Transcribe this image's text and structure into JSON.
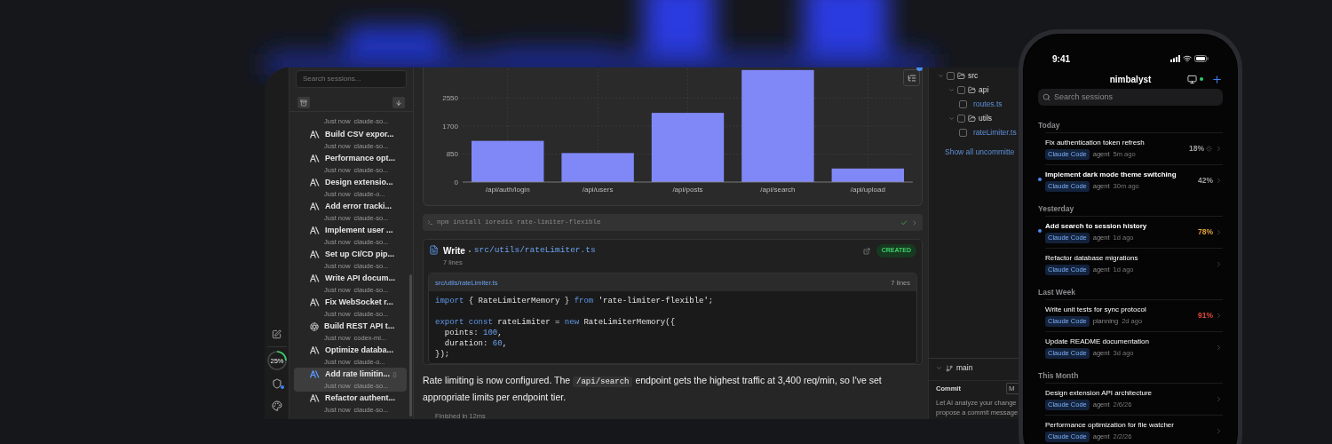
{
  "desktop": {
    "rail": {
      "usage": {
        "label": "25%",
        "level": 0.25
      },
      "shield_notice": true
    },
    "sidebar": {
      "search": {
        "placeholder": "Search sessions..."
      },
      "sessions": [
        {
          "kind": "cut",
          "time": "Just now",
          "source": "claude-so..."
        },
        {
          "kind": "claude",
          "title": "Build CSV expor...",
          "time": "Just now",
          "source": "claude-so...",
          "selected": false
        },
        {
          "kind": "claude",
          "title": "Performance opt...",
          "time": "Just now",
          "source": "claude-so...",
          "selected": false
        },
        {
          "kind": "claude",
          "title": "Design extensio...",
          "time": "Just now",
          "source": "claude-o...",
          "selected": false
        },
        {
          "kind": "claude",
          "title": "Add error tracki...",
          "time": "Just now",
          "source": "claude-so...",
          "selected": false
        },
        {
          "kind": "claude",
          "title": "Implement user ...",
          "time": "Just now",
          "source": "claude-so...",
          "selected": false
        },
        {
          "kind": "claude",
          "title": "Set up CI/CD pip...",
          "time": "Just now",
          "source": "claude-so...",
          "selected": false
        },
        {
          "kind": "claude",
          "title": "Write API docum...",
          "time": "Just now",
          "source": "claude-so...",
          "selected": false
        },
        {
          "kind": "claude",
          "title": "Fix WebSocket r...",
          "time": "Just now",
          "source": "claude-so...",
          "selected": false
        },
        {
          "kind": "codex",
          "title": "Build REST API t...",
          "time": "Just now",
          "source": "codex-mi...",
          "selected": false
        },
        {
          "kind": "claude",
          "title": "Optimize databa...",
          "time": "Just now",
          "source": "claude-o...",
          "selected": false
        },
        {
          "kind": "claude",
          "title": "Add rate limitin...",
          "time": "Just now",
          "source": "claude-so...",
          "selected": true
        },
        {
          "kind": "claude",
          "title": "Refactor authent...",
          "time": "Just now",
          "source": "claude-so...",
          "selected": false
        }
      ]
    },
    "main": {
      "chart_data": {
        "type": "bar",
        "categories": [
          "/api/auth/login",
          "/api/users",
          "/api/posts",
          "/api/search",
          "/api/upload"
        ],
        "values": [
          1250,
          880,
          2100,
          3400,
          410
        ],
        "ylim": [
          0,
          3450
        ],
        "yticks": [
          0,
          850,
          1700,
          2550
        ],
        "grid": true
      },
      "terminal": {
        "command": "npm install ioredis rate-limiter-flexible",
        "success": true
      },
      "write": {
        "action": "Write",
        "path": "src/utils/rateLimiter.ts",
        "line_count": "7 lines",
        "status": "CREATED",
        "file_header": {
          "path": "src/utils/rateLimiter.ts",
          "line_count": "7 lines"
        },
        "code": [
          {
            "kind": "code",
            "segments": [
              {
                "text": "import",
                "kind": "keyword"
              },
              {
                "text": " { RateLimiterMemory } ",
                "kind": "plain"
              },
              {
                "text": "from",
                "kind": "keyword"
              },
              {
                "text": " 'rate-limiter-flexible';",
                "kind": "plain"
              }
            ]
          },
          {
            "kind": "blank"
          },
          {
            "kind": "code",
            "segments": [
              {
                "text": "export const",
                "kind": "keyword"
              },
              {
                "text": " rateLimiter = ",
                "kind": "plain"
              },
              {
                "text": "new",
                "kind": "keyword"
              },
              {
                "text": " RateLimiterMemory({",
                "kind": "plain"
              }
            ]
          },
          {
            "kind": "code",
            "segments": [
              {
                "text": "  points: ",
                "kind": "plain"
              },
              {
                "text": "100",
                "kind": "number"
              },
              {
                "text": ",",
                "kind": "plain"
              }
            ]
          },
          {
            "kind": "code",
            "segments": [
              {
                "text": "  duration: ",
                "kind": "plain"
              },
              {
                "text": "60",
                "kind": "number"
              },
              {
                "text": ",",
                "kind": "plain"
              }
            ]
          },
          {
            "kind": "code",
            "segments": [
              {
                "text": "});",
                "kind": "plain"
              }
            ]
          }
        ]
      },
      "message": {
        "before": "Rate limiting is now configured. The ",
        "code": "/api/search",
        "after": " endpoint gets the highest traffic at 3,400 req/min, so I've set appropriate limits per endpoint tier."
      },
      "footer": "Finished in 12ms"
    },
    "changes": {
      "tree": [
        {
          "name": "src",
          "kind": "folder",
          "expanded": true,
          "checked": false,
          "children": [
            {
              "name": "api",
              "kind": "folder",
              "expanded": true,
              "checked": false,
              "children": [
                {
                  "name": "routes.ts",
                  "kind": "file",
                  "checked": false
                }
              ]
            },
            {
              "name": "utils",
              "kind": "folder",
              "expanded": true,
              "checked": false,
              "children": [
                {
                  "name": "rateLimiter.ts",
                  "kind": "file",
                  "checked": false
                }
              ]
            }
          ]
        }
      ],
      "show_all": "Show all uncommitte",
      "branch": {
        "name": "main",
        "expanded": true
      },
      "commit": {
        "title": "Commit",
        "button": "M",
        "hint_lines": [
          "Let AI analyze your change",
          "propose a commit message"
        ]
      }
    }
  },
  "phone": {
    "time": "9:41",
    "title": "nimbalyst",
    "connected": true,
    "search": {
      "placeholder": "Search sessions"
    },
    "sections": [
      {
        "label": "Today",
        "sessions": [
          {
            "title": "Fix authentication token refresh",
            "tag": "Claude Code",
            "mode": "agent",
            "time": "5m ago",
            "progress": "18%",
            "color": "#a0a0a0",
            "running": true,
            "unread": false
          },
          {
            "title": "Implement dark mode theme switching",
            "tag": "Claude Code",
            "mode": "agent",
            "time": "30m ago",
            "progress": "42%",
            "color": "#a0a0a0",
            "running": false,
            "unread": true
          }
        ]
      },
      {
        "label": "Yesterday",
        "sessions": [
          {
            "title": "Add search to session history",
            "tag": "Claude Code",
            "mode": "agent",
            "time": "1d ago",
            "progress": "78%",
            "color": "#e0a23c",
            "running": false,
            "unread": true
          },
          {
            "title": "Refactor database migrations",
            "tag": "Claude Code",
            "mode": "agent",
            "time": "1d ago",
            "running": false,
            "unread": false
          }
        ]
      },
      {
        "label": "Last Week",
        "sessions": [
          {
            "title": "Write unit tests for sync protocol",
            "tag": "Claude Code",
            "mode": "planning",
            "time": "2d ago",
            "progress": "91%",
            "color": "#e04a3c",
            "running": false,
            "unread": false
          },
          {
            "title": "Update README documentation",
            "tag": "Claude Code",
            "mode": "agent",
            "time": "3d ago",
            "running": false,
            "unread": false
          }
        ]
      },
      {
        "label": "This Month",
        "sessions": [
          {
            "title": "Design extension API architecture",
            "tag": "Claude Code",
            "mode": "agent",
            "time": "2/6/26",
            "running": false,
            "unread": false
          },
          {
            "title": "Performance optimization for file watcher",
            "tag": "Claude Code",
            "mode": "agent",
            "time": "2/2/26",
            "running": false,
            "unread": false
          }
        ]
      }
    ]
  }
}
